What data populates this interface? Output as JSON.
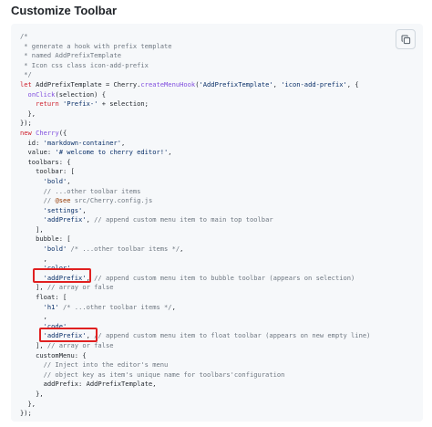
{
  "page": {
    "title": "Customize Toolbar"
  },
  "code_block": {
    "copy_icon": "copy-icon",
    "highlight_color": "#e02020",
    "lines": [
      [
        [
          "c",
          "/*"
        ]
      ],
      [
        [
          "c",
          " * generate a hook with prefix template"
        ]
      ],
      [
        [
          "c",
          " * named AddPrefixTemplate"
        ]
      ],
      [
        [
          "c",
          " * Icon css class icon-add-prefix"
        ]
      ],
      [
        [
          "c",
          " */"
        ]
      ],
      [
        [
          "k",
          "let "
        ],
        [
          "p",
          "AddPrefixTemplate = Cherry."
        ],
        [
          "f",
          "createMenuHook"
        ],
        [
          "p",
          "("
        ],
        [
          "s",
          "'AddPrefixTemplate'"
        ],
        [
          "p",
          ", "
        ],
        [
          "s",
          "'icon-add-prefix'"
        ],
        [
          "p",
          ", {"
        ]
      ],
      [
        [
          "p",
          "  "
        ],
        [
          "f",
          "onClick"
        ],
        [
          "p",
          "(selection) {"
        ]
      ],
      [
        [
          "p",
          "    "
        ],
        [
          "k",
          "return "
        ],
        [
          "s",
          "'Prefix-'"
        ],
        [
          "p",
          " + selection;"
        ]
      ],
      [
        [
          "p",
          "  },"
        ]
      ],
      [
        [
          "p",
          "});"
        ]
      ],
      [
        [
          "k",
          "new "
        ],
        [
          "f",
          "Cherry"
        ],
        [
          "p",
          "({"
        ]
      ],
      [
        [
          "p",
          "  id: "
        ],
        [
          "s",
          "'markdown-container'"
        ],
        [
          "p",
          ","
        ]
      ],
      [
        [
          "p",
          "  value: "
        ],
        [
          "s",
          "'# welcome to cherry editor!'"
        ],
        [
          "p",
          ","
        ]
      ],
      [
        [
          "p",
          "  toolbars: {"
        ]
      ],
      [
        [
          "p",
          "    toolbar: ["
        ]
      ],
      [
        [
          "p",
          "      "
        ],
        [
          "s",
          "'bold'"
        ],
        [
          "p",
          ","
        ]
      ],
      [
        [
          "p",
          "      "
        ],
        [
          "c",
          "// ...other toolbar items"
        ]
      ],
      [
        [
          "p",
          "      "
        ],
        [
          "c",
          "// "
        ],
        [
          "v",
          "@see"
        ],
        [
          "c",
          " src/Cherry.config.js"
        ]
      ],
      [
        [
          "p",
          "      "
        ],
        [
          "s",
          "'settings'"
        ],
        [
          "p",
          ","
        ]
      ],
      [
        [
          "p",
          "      "
        ],
        [
          "s",
          "'addPrefix'"
        ],
        [
          "p",
          ", "
        ],
        [
          "c",
          "// append custom menu item to main top toolbar"
        ]
      ],
      [
        [
          "p",
          "    ],"
        ]
      ],
      [
        [
          "p",
          "    bubble: ["
        ]
      ],
      [
        [
          "p",
          "      "
        ],
        [
          "s",
          "'bold'"
        ],
        [
          "p",
          " "
        ],
        [
          "c",
          "/* ...other toolbar items */"
        ],
        [
          "p",
          ","
        ]
      ],
      [
        [
          "p",
          "      ,"
        ]
      ],
      [
        [
          "p",
          "      "
        ],
        [
          "s",
          "'color'"
        ],
        [
          "p",
          ","
        ]
      ],
      [
        [
          "p",
          "      "
        ],
        [
          "s",
          "'addPrefix'"
        ],
        [
          "p",
          ", "
        ],
        [
          "c",
          "// append custom menu item to bubble toolbar (appears on selection)"
        ]
      ],
      [
        [
          "p",
          "    ], "
        ],
        [
          "c",
          "// array or false"
        ]
      ],
      [
        [
          "p",
          "    float: ["
        ]
      ],
      [
        [
          "p",
          "      "
        ],
        [
          "s",
          "'h1'"
        ],
        [
          "p",
          " "
        ],
        [
          "c",
          "/* ...other toolbar items */"
        ],
        [
          "p",
          ","
        ]
      ],
      [
        [
          "p",
          "      ,"
        ]
      ],
      [
        [
          "p",
          "      "
        ],
        [
          "s",
          "'code'"
        ],
        [
          "p",
          ","
        ]
      ],
      [
        [
          "p",
          "      "
        ],
        [
          "s",
          "'addPrefix'"
        ],
        [
          "p",
          ", "
        ],
        [
          "c",
          "// append custom menu item to float toolbar (appears on new empty line)"
        ]
      ],
      [
        [
          "p",
          "    ], "
        ],
        [
          "c",
          "// array or false"
        ]
      ],
      [
        [
          "p",
          "    customMenu: {"
        ]
      ],
      [
        [
          "p",
          "      "
        ],
        [
          "c",
          "// Inject into the editor's menu"
        ]
      ],
      [
        [
          "p",
          "      "
        ],
        [
          "c",
          "// object key as item's unique name for toolbars'configuration"
        ]
      ],
      [
        [
          "p",
          "      addPrefix: AddPrefixTemplate,"
        ]
      ],
      [
        [
          "p",
          "    },"
        ]
      ],
      [
        [
          "p",
          "  },"
        ]
      ],
      [
        [
          "p",
          "});"
        ]
      ]
    ]
  }
}
